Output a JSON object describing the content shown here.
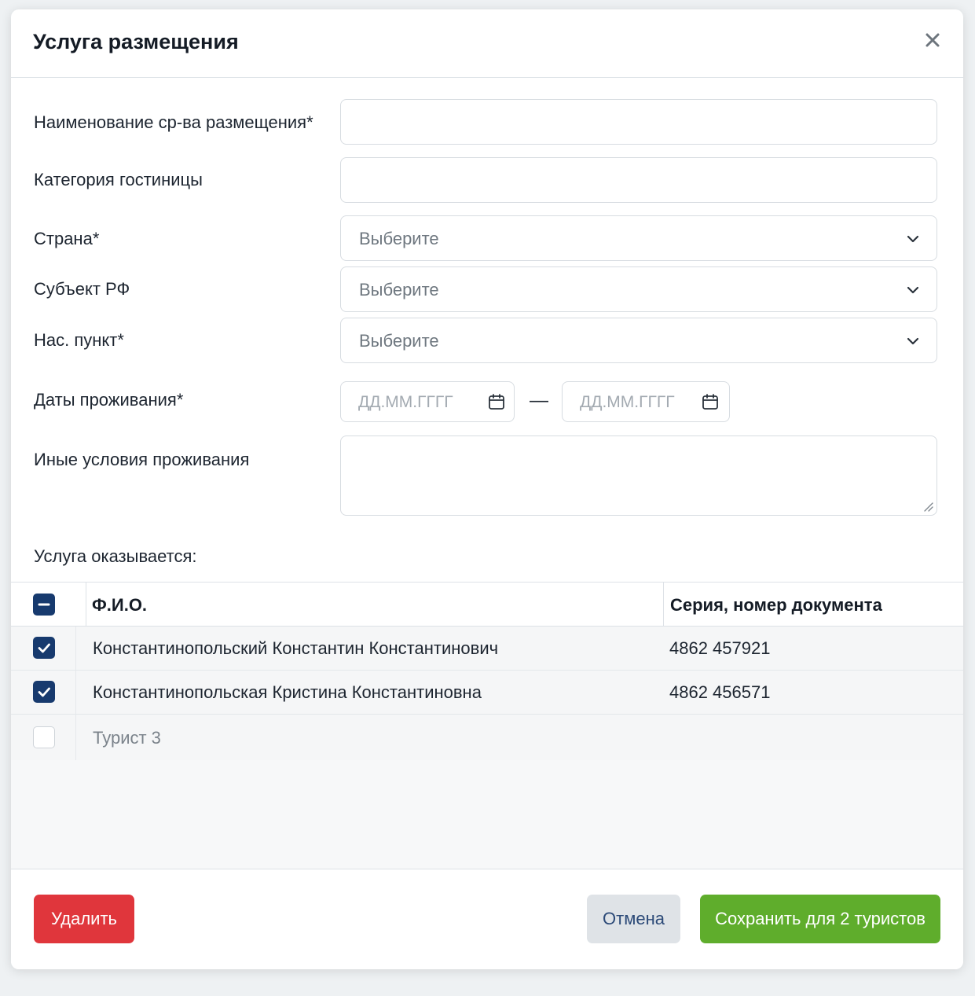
{
  "modal": {
    "title": "Услуга размещения"
  },
  "form": {
    "name_label": "Наименование ср-ва размещения*",
    "name_value": "",
    "category_label": "Категория гостиницы",
    "category_value": "",
    "country_label": "Страна*",
    "country_value": "Выберите",
    "region_label": "Субъект РФ",
    "region_value": "Выберите",
    "city_label": "Нас. пункт*",
    "city_value": "Выберите",
    "dates_label": "Даты проживания*",
    "date_from_placeholder": "ДД.ММ.ГГГГ",
    "date_to_placeholder": "ДД.ММ.ГГГГ",
    "date_separator": "—",
    "conditions_label": "Иные условия проживания",
    "conditions_value": ""
  },
  "tourists": {
    "section_label": "Услуга оказывается:",
    "columns": [
      "Ф.И.О.",
      "Серия, номер документа"
    ],
    "header_checkbox_state": "indeterminate",
    "rows": [
      {
        "name": "Константинопольский Константин Константинович",
        "document": "4862 457921",
        "checked": true
      },
      {
        "name": "Константинопольская Кристина Константиновна",
        "document": "4862 456571",
        "checked": true
      },
      {
        "name": "Турист 3",
        "document": "",
        "checked": false
      }
    ]
  },
  "footer": {
    "delete_label": "Удалить",
    "cancel_label": "Отмена",
    "save_label": "Сохранить для 2 туристов"
  },
  "colors": {
    "accent_navy": "#173a6e",
    "danger": "#e0363c",
    "success": "#5fad2c"
  },
  "icons": [
    "close-icon",
    "chevron-down-icon",
    "calendar-icon",
    "check-icon",
    "minus-icon",
    "resize-grip-icon"
  ]
}
